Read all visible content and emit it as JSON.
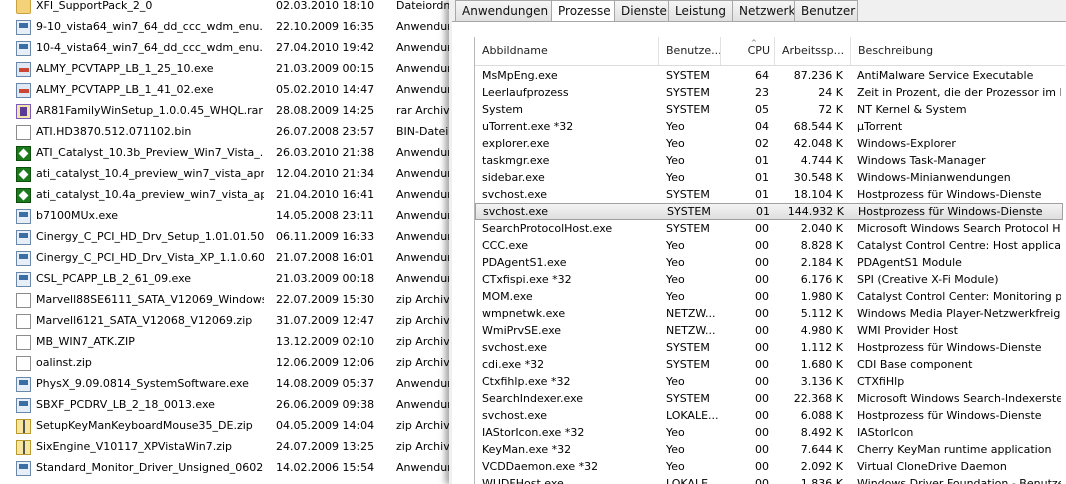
{
  "explorer": {
    "files": [
      {
        "name": "XFI_SupportPack_2_0",
        "date": "02.03.2010 18:10",
        "type": "Dateiordner",
        "icon": "folder-icon",
        "ic": "ic-folder"
      },
      {
        "name": "9-10_vista64_win7_64_dd_ccc_wdm_enu....",
        "date": "22.10.2009 16:35",
        "type": "Anwendung",
        "icon": "exe-icon",
        "ic": "ic-exe"
      },
      {
        "name": "10-4_vista64_win7_64_dd_ccc_wdm_enu....",
        "date": "27.04.2010 19:42",
        "type": "Anwendung",
        "icon": "exe-icon",
        "ic": "ic-exe"
      },
      {
        "name": "ALMY_PCVTAPP_LB_1_25_10.exe",
        "date": "21.03.2009 00:15",
        "type": "Anwendung",
        "icon": "setup-icon",
        "ic": "ic-setup"
      },
      {
        "name": "ALMY_PCVTAPP_LB_1_41_02.exe",
        "date": "05.02.2010 14:47",
        "type": "Anwendung",
        "icon": "setup-icon",
        "ic": "ic-setup"
      },
      {
        "name": "AR81FamilyWinSetup_1.0.0.45_WHQL.rar",
        "date": "28.08.2009 14:25",
        "type": "rar Archiv",
        "icon": "rar-archive-icon",
        "ic": "ic-rar"
      },
      {
        "name": "ATI.HD3870.512.071102.bin",
        "date": "26.07.2008 23:57",
        "type": "BIN-Datei",
        "icon": "document-icon",
        "ic": "ic-doc"
      },
      {
        "name": "ATI_Catalyst_10.3b_Preview_Win7_Vista_...",
        "date": "26.03.2010 21:38",
        "type": "Anwendung",
        "icon": "ati-icon",
        "ic": "ic-ati"
      },
      {
        "name": "ati_catalyst_10.4_preview_win7_vista_apr1...",
        "date": "12.04.2010 21:34",
        "type": "Anwendung",
        "icon": "ati-icon",
        "ic": "ic-ati"
      },
      {
        "name": "ati_catalyst_10.4a_preview_win7_vista_apr...",
        "date": "21.04.2010 16:41",
        "type": "Anwendung",
        "icon": "ati-icon",
        "ic": "ic-ati"
      },
      {
        "name": "b7100MUx.exe",
        "date": "14.05.2008 23:11",
        "type": "Anwendung",
        "icon": "exe-icon",
        "ic": "ic-exe"
      },
      {
        "name": "Cinergy_C_PCI_HD_Drv_Setup_1.01.01.50....",
        "date": "06.11.2009 16:33",
        "type": "Anwendung",
        "icon": "exe-icon",
        "ic": "ic-exe"
      },
      {
        "name": "Cinergy_C_PCI_HD_Drv_Vista_XP_1.1.0.60....",
        "date": "21.07.2008 16:01",
        "type": "Anwendung",
        "icon": "exe-icon",
        "ic": "ic-exe"
      },
      {
        "name": "CSL_PCAPP_LB_2_61_09.exe",
        "date": "21.03.2009 00:18",
        "type": "Anwendung",
        "icon": "exe-icon",
        "ic": "ic-exe"
      },
      {
        "name": "Marvell88SE6111_SATA_V12069_Windows....",
        "date": "22.07.2009 15:30",
        "type": "zip Archiv",
        "icon": "document-icon",
        "ic": "ic-doc"
      },
      {
        "name": "Marvell6121_SATA_V12068_V12069.zip",
        "date": "31.07.2009 12:47",
        "type": "zip Archiv",
        "icon": "document-icon",
        "ic": "ic-doc"
      },
      {
        "name": "MB_WIN7_ATK.ZIP",
        "date": "13.12.2009 02:10",
        "type": "zip Archiv",
        "icon": "document-icon",
        "ic": "ic-doc"
      },
      {
        "name": "oalinst.zip",
        "date": "12.06.2009 12:06",
        "type": "zip Archiv",
        "icon": "document-icon",
        "ic": "ic-doc"
      },
      {
        "name": "PhysX_9.09.0814_SystemSoftware.exe",
        "date": "14.08.2009 05:37",
        "type": "Anwendung",
        "icon": "exe-icon",
        "ic": "ic-exe"
      },
      {
        "name": "SBXF_PCDRV_LB_2_18_0013.exe",
        "date": "26.06.2009 09:38",
        "type": "Anwendung",
        "icon": "exe-icon",
        "ic": "ic-exe"
      },
      {
        "name": "SetupKeyManKeyboardMouse35_DE.zip",
        "date": "04.05.2009 14:04",
        "type": "zip Archiv",
        "icon": "zip-icon",
        "ic": "ic-zip"
      },
      {
        "name": "SixEngine_V10117_XPVistaWin7.zip",
        "date": "24.07.2009 13:25",
        "type": "zip Archiv",
        "icon": "zip-icon",
        "ic": "ic-zip"
      },
      {
        "name": "Standard_Monitor_Driver_Unsigned_0602...",
        "date": "14.02.2006 15:54",
        "type": "Anwendung",
        "icon": "exe-icon",
        "ic": "ic-exe"
      }
    ]
  },
  "taskmanager": {
    "tabs": [
      {
        "label": "Anwendungen",
        "active": false
      },
      {
        "label": "Prozesse",
        "active": true
      },
      {
        "label": "Dienste",
        "active": false
      },
      {
        "label": "Leistung",
        "active": false
      },
      {
        "label": "Netzwerk",
        "active": false
      },
      {
        "label": "Benutzer",
        "active": false
      }
    ],
    "columns": {
      "name": "Abbildname",
      "user": "Benutze...",
      "cpu": "CPU",
      "mem": "Arbeitssp...",
      "desc": "Beschreibung",
      "sort_indicator": "^"
    },
    "processes": [
      {
        "name": "MsMpEng.exe",
        "user": "SYSTEM",
        "cpu": "64",
        "mem": "87.236 K",
        "desc": "AntiMalware Service Executable",
        "selected": false
      },
      {
        "name": "Leerlaufprozess",
        "user": "SYSTEM",
        "cpu": "23",
        "mem": "24 K",
        "desc": "Zeit in Prozent, die der Prozessor im L...",
        "selected": false
      },
      {
        "name": "System",
        "user": "SYSTEM",
        "cpu": "05",
        "mem": "72 K",
        "desc": "NT Kernel & System",
        "selected": false
      },
      {
        "name": "uTorrent.exe *32",
        "user": "Yeo",
        "cpu": "04",
        "mem": "68.544 K",
        "desc": "µTorrent",
        "selected": false
      },
      {
        "name": "explorer.exe",
        "user": "Yeo",
        "cpu": "02",
        "mem": "42.048 K",
        "desc": "Windows-Explorer",
        "selected": false
      },
      {
        "name": "taskmgr.exe",
        "user": "Yeo",
        "cpu": "01",
        "mem": "4.744 K",
        "desc": "Windows Task-Manager",
        "selected": false
      },
      {
        "name": "sidebar.exe",
        "user": "Yeo",
        "cpu": "01",
        "mem": "30.548 K",
        "desc": "Windows-Minianwendungen",
        "selected": false
      },
      {
        "name": "svchost.exe",
        "user": "SYSTEM",
        "cpu": "01",
        "mem": "18.104 K",
        "desc": "Hostprozess für Windows-Dienste",
        "selected": false
      },
      {
        "name": "svchost.exe",
        "user": "SYSTEM",
        "cpu": "01",
        "mem": "144.932 K",
        "desc": "Hostprozess für Windows-Dienste",
        "selected": true
      },
      {
        "name": "SearchProtocolHost.exe",
        "user": "SYSTEM",
        "cpu": "00",
        "mem": "2.040 K",
        "desc": "Microsoft Windows Search Protocol Host",
        "selected": false
      },
      {
        "name": "CCC.exe",
        "user": "Yeo",
        "cpu": "00",
        "mem": "8.828 K",
        "desc": "Catalyst Control Centre: Host application",
        "selected": false
      },
      {
        "name": "PDAgentS1.exe",
        "user": "Yeo",
        "cpu": "00",
        "mem": "2.184 K",
        "desc": "PDAgentS1 Module",
        "selected": false
      },
      {
        "name": "CTxfispi.exe *32",
        "user": "Yeo",
        "cpu": "00",
        "mem": "6.176 K",
        "desc": "SPI (Creative X-Fi Module)",
        "selected": false
      },
      {
        "name": "MOM.exe",
        "user": "Yeo",
        "cpu": "00",
        "mem": "1.980 K",
        "desc": "Catalyst Control Center: Monitoring pr...",
        "selected": false
      },
      {
        "name": "wmpnetwk.exe",
        "user": "NETZW...",
        "cpu": "00",
        "mem": "5.112 K",
        "desc": "Windows Media Player-Netzwerkfreiga...",
        "selected": false
      },
      {
        "name": "WmiPrvSE.exe",
        "user": "NETZW...",
        "cpu": "00",
        "mem": "4.980 K",
        "desc": "WMI Provider Host",
        "selected": false
      },
      {
        "name": "svchost.exe",
        "user": "SYSTEM",
        "cpu": "00",
        "mem": "1.112 K",
        "desc": "Hostprozess für Windows-Dienste",
        "selected": false
      },
      {
        "name": "cdi.exe *32",
        "user": "SYSTEM",
        "cpu": "00",
        "mem": "1.680 K",
        "desc": "CDI Base component",
        "selected": false
      },
      {
        "name": "Ctxfihlp.exe *32",
        "user": "Yeo",
        "cpu": "00",
        "mem": "3.136 K",
        "desc": "CTXfiHlp",
        "selected": false
      },
      {
        "name": "SearchIndexer.exe",
        "user": "SYSTEM",
        "cpu": "00",
        "mem": "22.368 K",
        "desc": "Microsoft Windows Search-Indexerstel...",
        "selected": false
      },
      {
        "name": "svchost.exe",
        "user": "LOKALE...",
        "cpu": "00",
        "mem": "6.088 K",
        "desc": "Hostprozess für Windows-Dienste",
        "selected": false
      },
      {
        "name": "IAStorIcon.exe *32",
        "user": "Yeo",
        "cpu": "00",
        "mem": "8.492 K",
        "desc": "IAStorIcon",
        "selected": false
      },
      {
        "name": "KeyMan.exe *32",
        "user": "Yeo",
        "cpu": "00",
        "mem": "7.644 K",
        "desc": "Cherry KeyMan runtime application",
        "selected": false
      },
      {
        "name": "VCDDaemon.exe *32",
        "user": "Yeo",
        "cpu": "00",
        "mem": "2.092 K",
        "desc": "Virtual CloneDrive Daemon",
        "selected": false
      },
      {
        "name": "WUDFHost.exe",
        "user": "LOKALE...",
        "cpu": "00",
        "mem": "1.836 K",
        "desc": "Windows Driver Foundation - Benutzer...",
        "selected": false
      }
    ]
  }
}
